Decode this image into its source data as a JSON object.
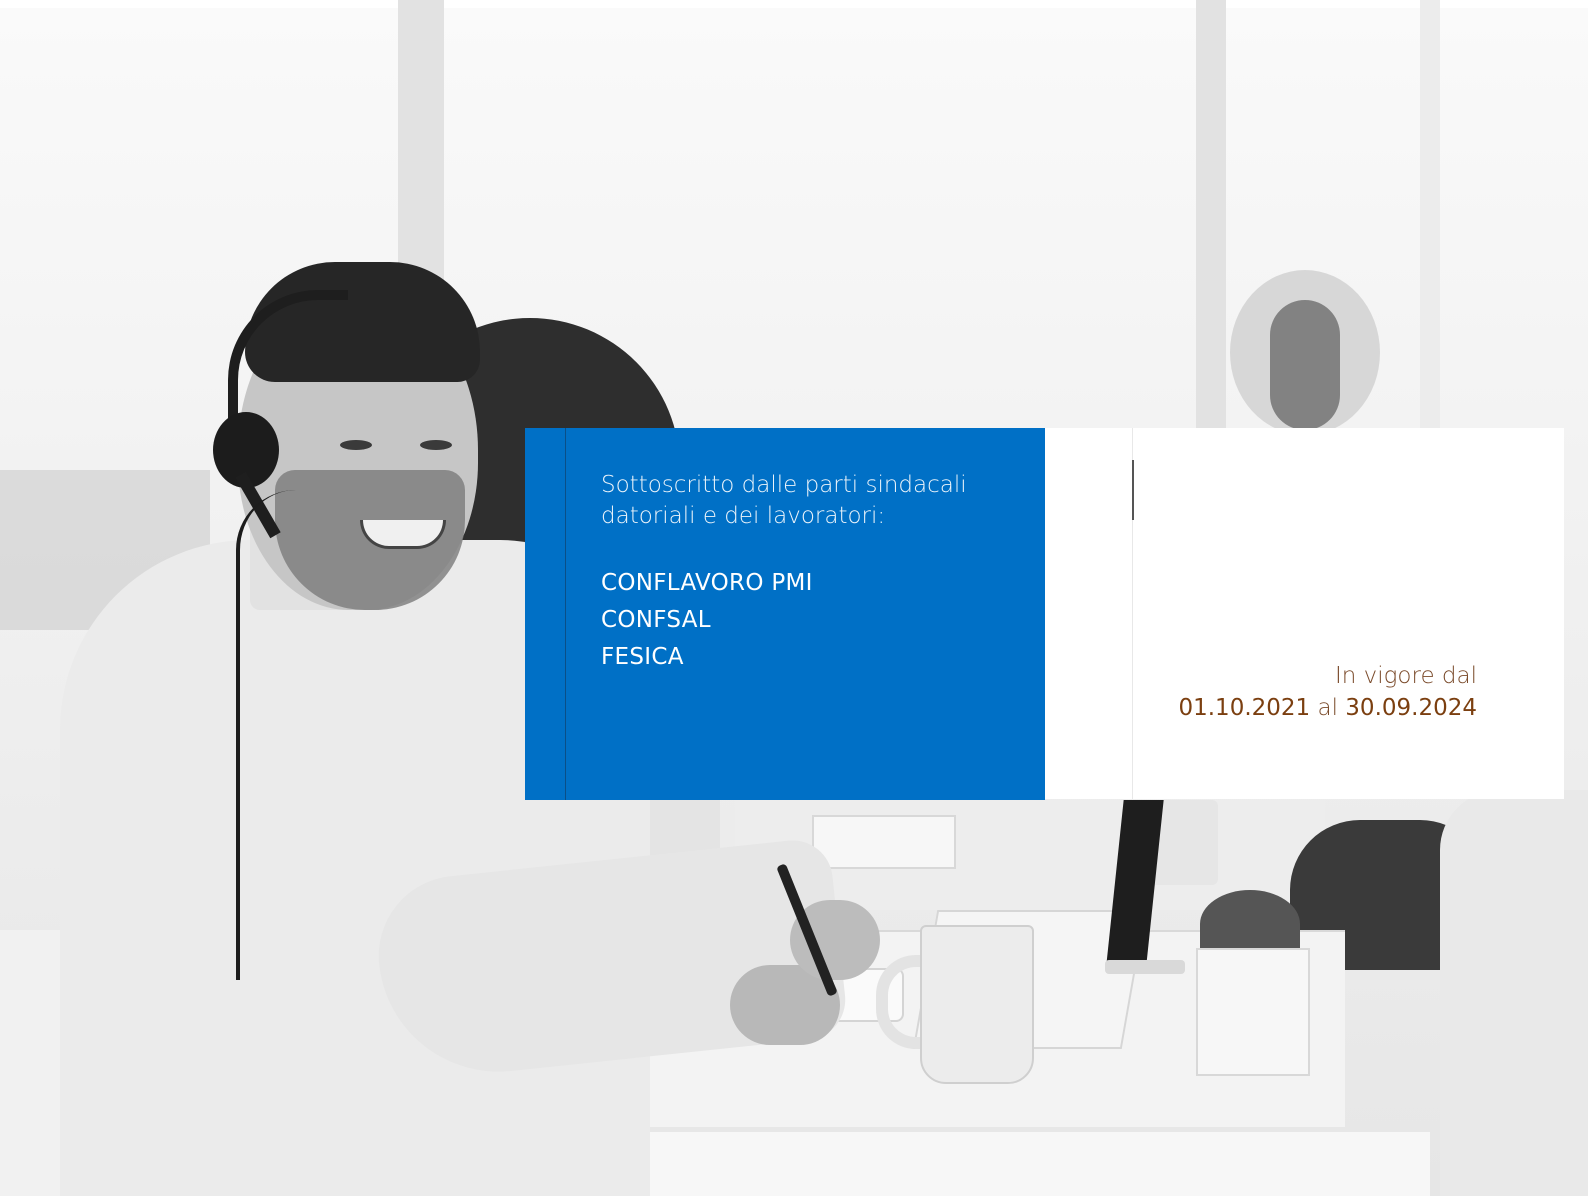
{
  "signatories": {
    "intro_line1": "Sottoscritto dalle parti sindacali",
    "intro_line2": "datoriali e dei lavoratori:",
    "parties": [
      "CONFLAVORO PMI",
      "CONFSAL",
      "FESICA"
    ]
  },
  "validity": {
    "label": "In vigore dal",
    "start_date": "01.10.2021",
    "connector": "al",
    "end_date": "30.09.2024"
  },
  "colors": {
    "panel_blue": "#0070c6",
    "date_brown": "#7b3f10",
    "panel_white": "#ffffff"
  }
}
